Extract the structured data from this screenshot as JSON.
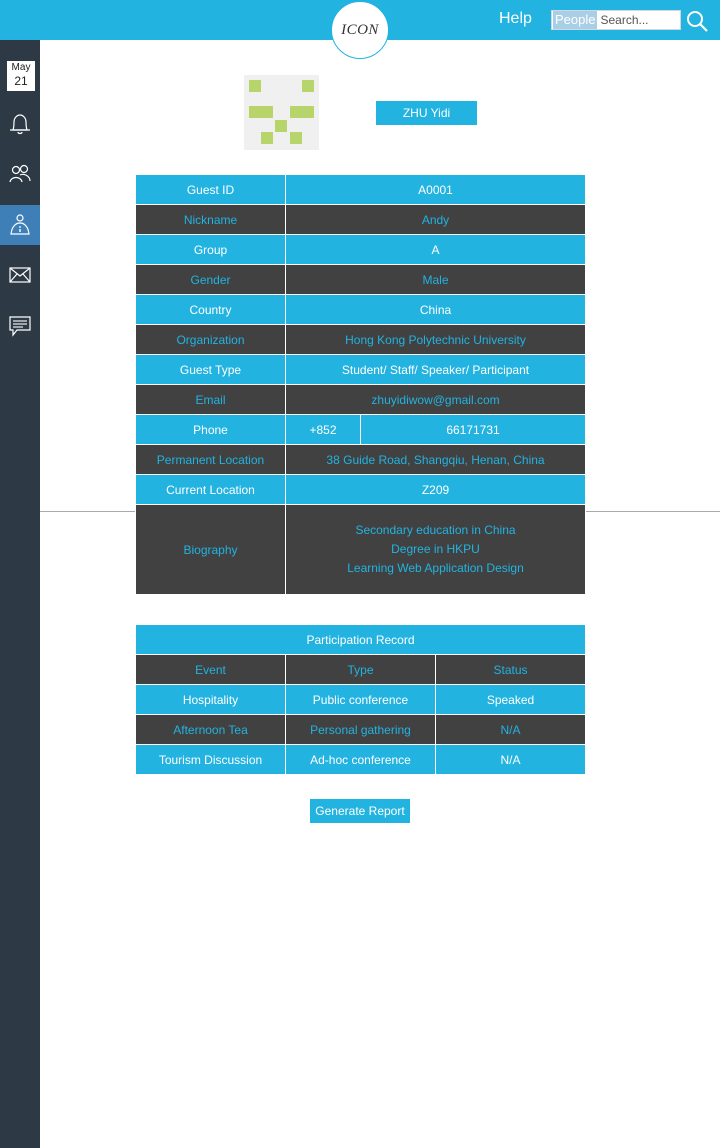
{
  "header": {
    "logo_text": "ICON",
    "help_label": "Help",
    "search_scope": "People",
    "search_placeholder": "Search...",
    "accent_color": "#22b3e1"
  },
  "sidebar": {
    "calendar": {
      "month": "May",
      "day": "21"
    },
    "items": [
      {
        "icon": "bell-icon"
      },
      {
        "icon": "people-icon"
      },
      {
        "icon": "guest-info-icon",
        "active": true
      },
      {
        "icon": "mail-icon"
      },
      {
        "icon": "chat-icon"
      }
    ],
    "color": "#2d3a46",
    "active_color": "#3f7fb8"
  },
  "profile": {
    "name_label": "ZHU Yidi",
    "avatar_icon": "identicon-avatar"
  },
  "guest_info": {
    "rows": [
      {
        "label": "Guest ID",
        "value": "A0001"
      },
      {
        "label": "Nickname",
        "value": "Andy"
      },
      {
        "label": "Group",
        "value": "A"
      },
      {
        "label": "Gender",
        "value": "Male"
      },
      {
        "label": "Country",
        "value": "China"
      },
      {
        "label": "Organization",
        "value": "Hong Kong Polytechnic University"
      },
      {
        "label": "Guest Type",
        "value": "Student/ Staff/ Speaker/ Participant"
      },
      {
        "label": "Email",
        "value": "zhuyidiwow@gmail.com"
      },
      {
        "label": "Phone",
        "code": "+852",
        "value": "66171731"
      },
      {
        "label": "Permanent Location",
        "value": "38 Guide Road, Shangqiu, Henan, China"
      },
      {
        "label": "Current Location",
        "value": "Z209"
      },
      {
        "label": "Biography",
        "lines": [
          "Secondary education in China",
          "Degree in HKPU",
          "Learning Web Application Design"
        ]
      }
    ]
  },
  "participation": {
    "title": "Participation Record",
    "headers": [
      "Event",
      "Type",
      "Status"
    ],
    "rows": [
      [
        "Hospitality",
        "Public conference",
        "Speaked"
      ],
      [
        "Afternoon Tea",
        "Personal gathering",
        "N/A"
      ],
      [
        "Tourism Discussion",
        "Ad-hoc conference",
        "N/A"
      ]
    ]
  },
  "actions": {
    "generate_report_label": "Generate Report"
  }
}
